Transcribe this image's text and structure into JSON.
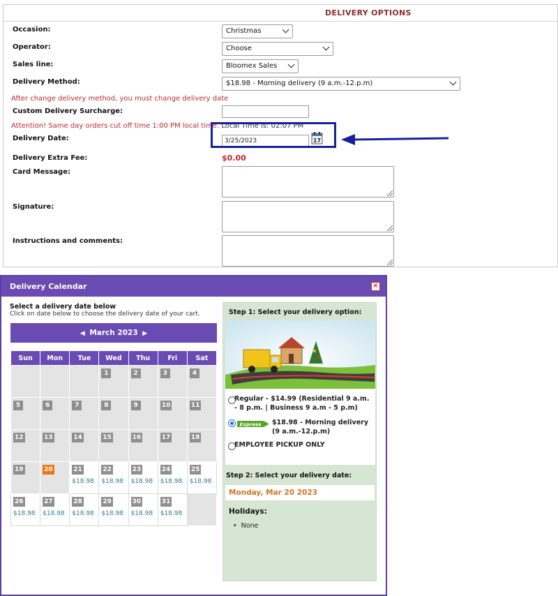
{
  "form": {
    "title": "DELIVERY OPTIONS",
    "occasion_label": "Occasion:",
    "occasion_value": "Christmas",
    "operator_label": "Operator:",
    "operator_value": "Choose",
    "sales_line_label": "Sales line:",
    "sales_line_value": "Bloomex Sales",
    "delivery_method_label": "Delivery Method:",
    "delivery_method_value": "$18.98 - Morning delivery (9 a.m.-12.p.m)",
    "method_warning": "After change delivery method, you must change delivery date",
    "surcharge_label": "Custom Delivery Surcharge:",
    "surcharge_value": "",
    "cutoff_warning": "Attention! Same day orders cut off time 1:00 PM local time.",
    "local_time": "Local Time is: 02:07 PM",
    "delivery_date_label": "Delivery Date:",
    "delivery_date_value": "3/25/2023",
    "extra_fee_label": "Delivery Extra Fee:",
    "extra_fee_value": "$0.00",
    "card_message_label": "Card Message:",
    "signature_label": "Signature:",
    "instructions_label": "Instructions and comments:"
  },
  "modal": {
    "title": "Delivery Calendar",
    "close_icon": "close-icon",
    "select_heading": "Select a delivery date below",
    "select_sub": "Click on date below to choose the delivery date of your cart.",
    "month": "March 2023",
    "weekdays": [
      "Sun",
      "Mon",
      "Tue",
      "Wed",
      "Thu",
      "Fri",
      "Sat"
    ],
    "weeks": [
      [
        null,
        null,
        null,
        {
          "d": "1"
        },
        {
          "d": "2"
        },
        {
          "d": "3"
        },
        {
          "d": "4"
        }
      ],
      [
        {
          "d": "5"
        },
        {
          "d": "6"
        },
        {
          "d": "7"
        },
        {
          "d": "8"
        },
        {
          "d": "9"
        },
        {
          "d": "10"
        },
        {
          "d": "11"
        }
      ],
      [
        {
          "d": "12"
        },
        {
          "d": "13"
        },
        {
          "d": "14"
        },
        {
          "d": "15"
        },
        {
          "d": "16"
        },
        {
          "d": "17"
        },
        {
          "d": "18"
        }
      ],
      [
        {
          "d": "19"
        },
        {
          "d": "20",
          "today": true
        },
        {
          "d": "21",
          "p": "$18.98"
        },
        {
          "d": "22",
          "p": "$18.98"
        },
        {
          "d": "23",
          "p": "$18.98"
        },
        {
          "d": "24",
          "p": "$18.98"
        },
        {
          "d": "25",
          "p": "$18.98"
        }
      ],
      [
        {
          "d": "26",
          "p": "$18.98"
        },
        {
          "d": "27",
          "p": "$18.98"
        },
        {
          "d": "28",
          "p": "$18.98"
        },
        {
          "d": "29",
          "p": "$18.98"
        },
        {
          "d": "30",
          "p": "$18.98"
        },
        {
          "d": "31",
          "p": "$18.98"
        },
        null
      ]
    ],
    "step1": "Step 1: Select your delivery option:",
    "options": [
      {
        "label": "Regular - $14.99 (Residential 9 a.m. - 8 p.m. | Business 9 a.m - 5 p.m)",
        "selected": false
      },
      {
        "label": "$18.98 - Morning delivery (9 a.m.-12.p.m)",
        "selected": true
      },
      {
        "label": "EMPLOYEE PICKUP ONLY",
        "selected": false
      }
    ],
    "express_badge": "Express",
    "step2": "Step 2: Select your delivery date:",
    "selected_date": "Monday, Mar 20 2023",
    "holidays_title": "Holidays:",
    "holidays": [
      "None"
    ]
  },
  "colors": {
    "purple": "#6a4bb4",
    "highlight_blue": "#14219c",
    "warning_red": "#c0282d",
    "today_orange": "#ee7612",
    "price_teal": "#2c7a9b",
    "side_green": "#d6e6d2"
  }
}
